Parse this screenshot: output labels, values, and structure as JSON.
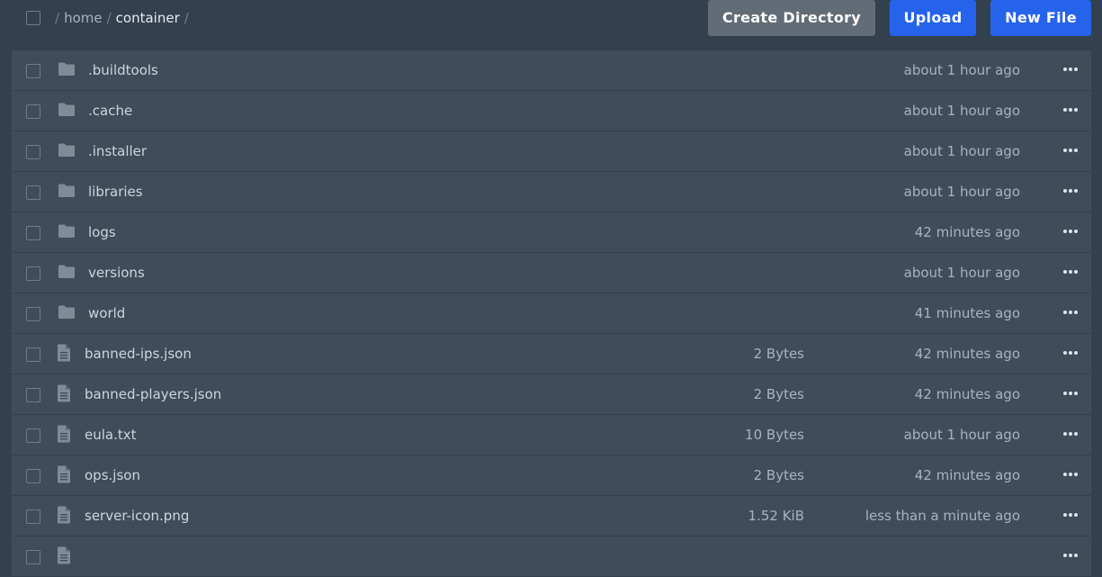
{
  "breadcrumb": {
    "separator": "/",
    "items": [
      "home",
      "container"
    ]
  },
  "toolbar": {
    "create_directory_label": "Create Directory",
    "upload_label": "Upload",
    "new_file_label": "New File"
  },
  "colors": {
    "background": "#33404d",
    "row_background": "#3f4d5a",
    "primary_button": "#2563eb",
    "secondary_button": "#626c77"
  },
  "files": [
    {
      "type": "folder",
      "icon": "folder-icon",
      "name": ".buildtools",
      "size": "",
      "modified": "about 1 hour ago"
    },
    {
      "type": "folder",
      "icon": "folder-icon",
      "name": ".cache",
      "size": "",
      "modified": "about 1 hour ago"
    },
    {
      "type": "folder",
      "icon": "folder-icon",
      "name": ".installer",
      "size": "",
      "modified": "about 1 hour ago"
    },
    {
      "type": "folder",
      "icon": "folder-icon",
      "name": "libraries",
      "size": "",
      "modified": "about 1 hour ago"
    },
    {
      "type": "folder",
      "icon": "folder-icon",
      "name": "logs",
      "size": "",
      "modified": "42 minutes ago"
    },
    {
      "type": "folder",
      "icon": "folder-icon",
      "name": "versions",
      "size": "",
      "modified": "about 1 hour ago"
    },
    {
      "type": "folder",
      "icon": "folder-icon",
      "name": "world",
      "size": "",
      "modified": "41 minutes ago"
    },
    {
      "type": "file",
      "icon": "file-icon",
      "name": "banned-ips.json",
      "size": "2 Bytes",
      "modified": "42 minutes ago"
    },
    {
      "type": "file",
      "icon": "file-icon",
      "name": "banned-players.json",
      "size": "2 Bytes",
      "modified": "42 minutes ago"
    },
    {
      "type": "file",
      "icon": "file-icon",
      "name": "eula.txt",
      "size": "10 Bytes",
      "modified": "about 1 hour ago"
    },
    {
      "type": "file",
      "icon": "file-icon",
      "name": "ops.json",
      "size": "2 Bytes",
      "modified": "42 minutes ago"
    },
    {
      "type": "file",
      "icon": "file-icon",
      "name": "server-icon.png",
      "size": "1.52 KiB",
      "modified": "less than a minute ago"
    },
    {
      "type": "file",
      "icon": "file-icon",
      "name": "",
      "size": "",
      "modified": ""
    }
  ]
}
